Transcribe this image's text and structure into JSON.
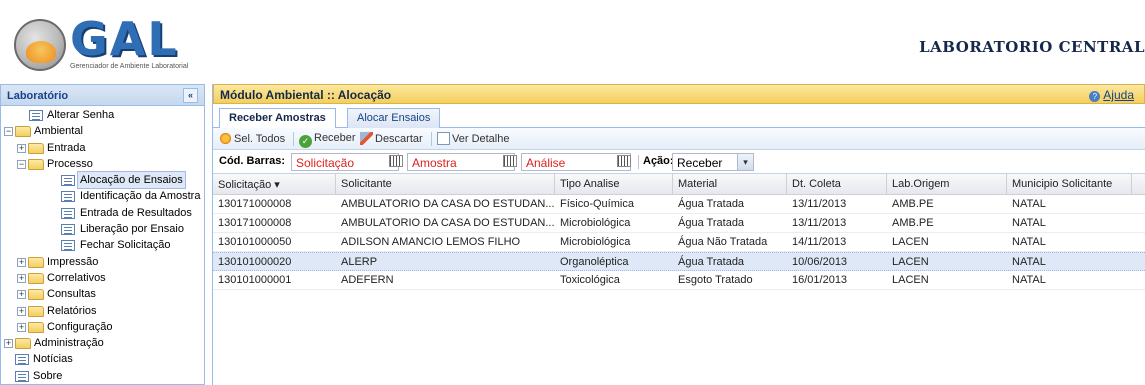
{
  "header": {
    "logo_text": "GAL",
    "logo_subtitle": "Gerenciador de Ambiente Laboratorial",
    "right_title": "LABORATORIO CENTRAL"
  },
  "sidebar": {
    "title": "Laboratório",
    "collapse_glyph": "«",
    "items": [
      {
        "label": "Alterar Senha"
      },
      {
        "label": "Ambiental"
      },
      {
        "label": "Entrada"
      },
      {
        "label": "Processo"
      },
      {
        "label": "Alocação de Ensaios"
      },
      {
        "label": "Identificação da Amostra"
      },
      {
        "label": "Entrada de Resultados"
      },
      {
        "label": "Liberação por Ensaio"
      },
      {
        "label": "Fechar Solicitação"
      },
      {
        "label": "Impressão"
      },
      {
        "label": "Correlativos"
      },
      {
        "label": "Consultas"
      },
      {
        "label": "Relatórios"
      },
      {
        "label": "Configuração"
      },
      {
        "label": "Administração"
      },
      {
        "label": "Notícias"
      },
      {
        "label": "Sobre"
      }
    ]
  },
  "main": {
    "title": "Módulo Ambiental :: Alocação",
    "help_label": "Ajuda",
    "tabs": [
      {
        "label": "Receber Amostras"
      },
      {
        "label": "Alocar Ensaios"
      }
    ],
    "toolbar": {
      "select_all": "Sel. Todos",
      "receive": "Receber",
      "discard": "Descartar",
      "view_detail": "Ver Detalhe"
    },
    "filter": {
      "label": "Cód. Barras:",
      "solicitacao": "Solicitação",
      "amostra": "Amostra",
      "analise": "Análise",
      "acao_label": "Ação:",
      "acao_value": "Receber"
    },
    "grid": {
      "columns": [
        "Solicitação ▾",
        "Solicitante",
        "Tipo Analise",
        "Material",
        "Dt. Coleta",
        "Lab.Origem",
        "Municipio Solicitante"
      ],
      "rows": [
        [
          "130171000008",
          "AMBULATORIO DA CASA DO ESTUDAN...",
          "Físico-Química",
          "Água Tratada",
          "13/11/2013",
          "AMB.PE",
          "NATAL"
        ],
        [
          "130171000008",
          "AMBULATORIO DA CASA DO ESTUDAN...",
          "Microbiológica",
          "Água Tratada",
          "13/11/2013",
          "AMB.PE",
          "NATAL"
        ],
        [
          "130101000050",
          "ADILSON AMANCIO LEMOS FILHO",
          "Microbiológica",
          "Água Não Tratada",
          "14/11/2013",
          "LACEN",
          "NATAL"
        ],
        [
          "130101000020",
          "ALERP",
          "Organoléptica",
          "Água Tratada",
          "10/06/2013",
          "LACEN",
          "NATAL"
        ],
        [
          "130101000001",
          "ADEFERN",
          "Toxicológica",
          "Esgoto Tratado",
          "16/01/2013",
          "LACEN",
          "NATAL"
        ]
      ]
    }
  },
  "colors": {
    "accent_blue": "#15428b",
    "header_gold": "#f3cf5a",
    "barcode_text": "#e02020",
    "selection": "#dfe8f6"
  }
}
